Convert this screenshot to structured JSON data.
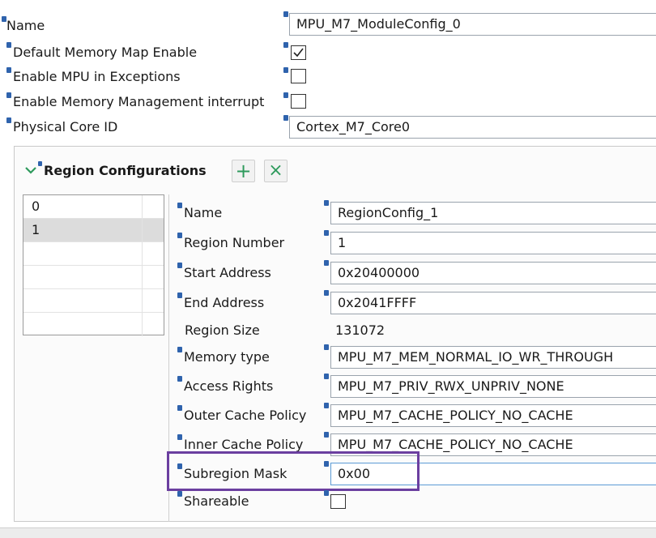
{
  "general": {
    "name_label": "Name",
    "name_value": "MPU_M7_ModuleConfig_0",
    "default_map_label": "Default Memory Map Enable",
    "default_map_checked": true,
    "mpu_exceptions_label": "Enable MPU in Exceptions",
    "mpu_exceptions_checked": false,
    "mem_mgmt_label": "Enable Memory Management interrupt",
    "mem_mgmt_checked": false,
    "core_id_label": "Physical Core ID",
    "core_id_value": "Cortex_M7_Core0"
  },
  "regions": {
    "title": "Region Configurations",
    "add_icon": "plus-icon",
    "remove_icon": "x-icon",
    "add_glyph": "+",
    "remove_glyph": "×",
    "list": [
      "0",
      "1"
    ],
    "selected_index": 1
  },
  "detail": {
    "name_label": "Name",
    "name_value": "RegionConfig_1",
    "region_number_label": "Region Number",
    "region_number_value": "1",
    "start_label": "Start Address",
    "start_value": "0x20400000",
    "end_label": "End Address",
    "end_value": "0x2041FFFF",
    "size_label": "Region Size",
    "size_value": "131072",
    "memtype_label": "Memory type",
    "memtype_value": "MPU_M7_MEM_NORMAL_IO_WR_THROUGH",
    "access_label": "Access Rights",
    "access_value": "MPU_M7_PRIV_RWX_UNPRIV_NONE",
    "outer_label": "Outer Cache Policy",
    "outer_value": "MPU_M7_CACHE_POLICY_NO_CACHE",
    "inner_label": "Inner Cache Policy",
    "inner_value": "MPU_M7_CACHE_POLICY_NO_CACHE",
    "subregion_label": "Subregion Mask",
    "subregion_value": "0x00",
    "shareable_label": "Shareable",
    "shareable_checked": false
  },
  "colors": {
    "info_icon": "#2f63ad",
    "add_remove_icons": "#2e9a5c",
    "highlight_border": "#6b3fa0"
  }
}
